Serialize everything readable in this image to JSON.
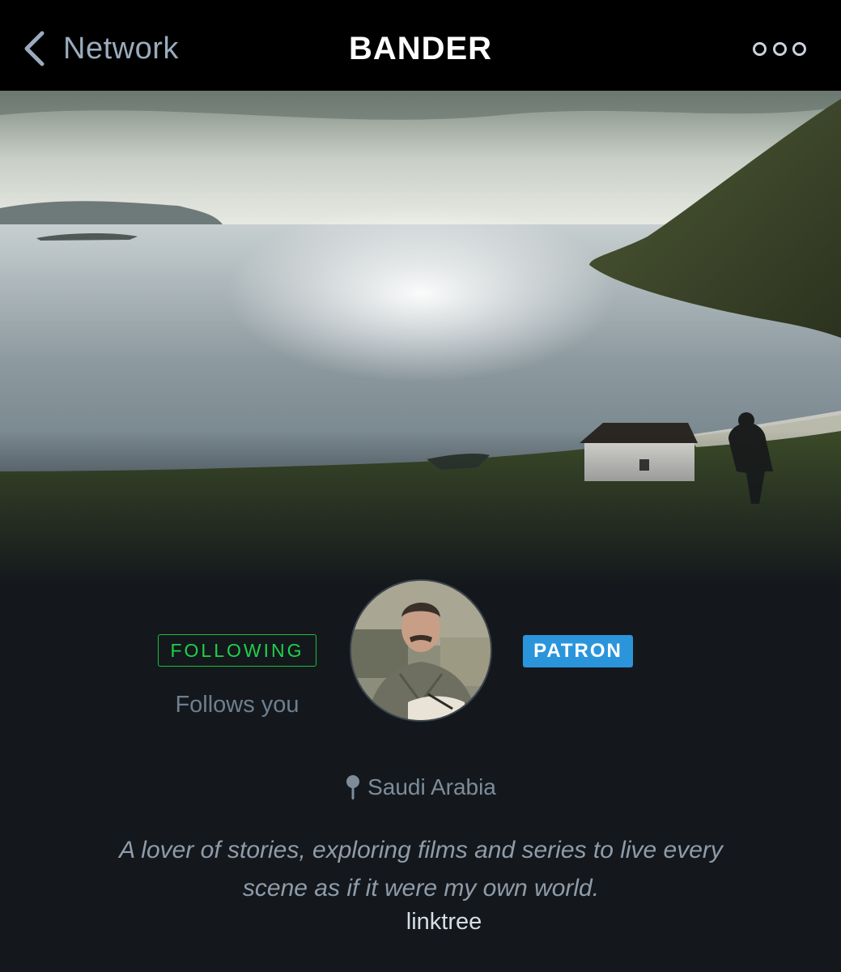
{
  "nav": {
    "back_label": "Network",
    "title": "BANDER",
    "back_icon": "chevron-left-icon",
    "more_icon": "more-icon"
  },
  "profile": {
    "following_label": "FOLLOWING",
    "follows_you": "Follows you",
    "patron_label": "PATRON",
    "location": "Saudi Arabia",
    "bio_line1": "A lover of stories, exploring films and series to live every",
    "bio_line2": "scene as if it were my own world.",
    "link": "linktree"
  },
  "colors": {
    "following": "#1fd04a",
    "patron": "#2b95db",
    "background": "#14181c"
  }
}
